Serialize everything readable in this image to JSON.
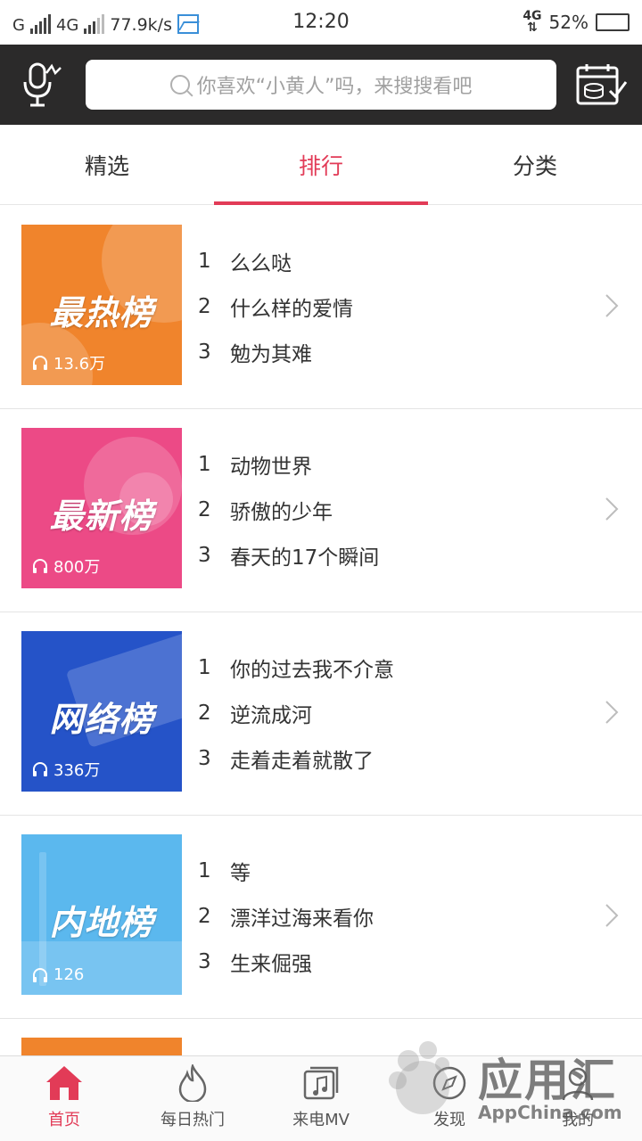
{
  "status_bar": {
    "carrier1": "G",
    "carrier2": "4G",
    "speed": "77.9k/s",
    "time": "12:20",
    "net_right": "4G",
    "battery_pct": "52%",
    "battery_level": 0.52
  },
  "header": {
    "search_placeholder": "你喜欢“小黄人”吗，来搜搜看吧"
  },
  "tabs": [
    {
      "label": "精选",
      "active": false
    },
    {
      "label": "排行",
      "active": true
    },
    {
      "label": "分类",
      "active": false
    }
  ],
  "charts": [
    {
      "title": "最热榜",
      "plays": "13.6万",
      "color": "#f0842c",
      "songs": [
        {
          "rank": "1",
          "name": "么么哒"
        },
        {
          "rank": "2",
          "name": "什么样的爱情"
        },
        {
          "rank": "3",
          "name": "勉为其难"
        }
      ]
    },
    {
      "title": "最新榜",
      "plays": "800万",
      "color": "#ec4a86",
      "songs": [
        {
          "rank": "1",
          "name": "动物世界"
        },
        {
          "rank": "2",
          "name": "骄傲的少年"
        },
        {
          "rank": "3",
          "name": "春天的17个瞬间"
        }
      ]
    },
    {
      "title": "网络榜",
      "plays": "336万",
      "color": "#2553c8",
      "songs": [
        {
          "rank": "1",
          "name": "你的过去我不介意"
        },
        {
          "rank": "2",
          "name": "逆流成河"
        },
        {
          "rank": "3",
          "name": "走着走着就散了"
        }
      ]
    },
    {
      "title": "内地榜",
      "plays": "126",
      "color": "#5bb8ee",
      "songs": [
        {
          "rank": "1",
          "name": "等"
        },
        {
          "rank": "2",
          "name": "漂洋过海来看你"
        },
        {
          "rank": "3",
          "name": "生来倔强"
        }
      ]
    }
  ],
  "bottom_nav": [
    {
      "label": "首页",
      "icon": "home-icon",
      "active": true
    },
    {
      "label": "每日热门",
      "icon": "flame-icon",
      "active": false
    },
    {
      "label": "来电MV",
      "icon": "mv-icon",
      "active": false
    },
    {
      "label": "发现",
      "icon": "discover-icon",
      "active": false
    },
    {
      "label": "我的",
      "icon": "profile-icon",
      "active": false
    }
  ],
  "watermark": {
    "text": "应用汇",
    "sub": "AppChina.com"
  }
}
